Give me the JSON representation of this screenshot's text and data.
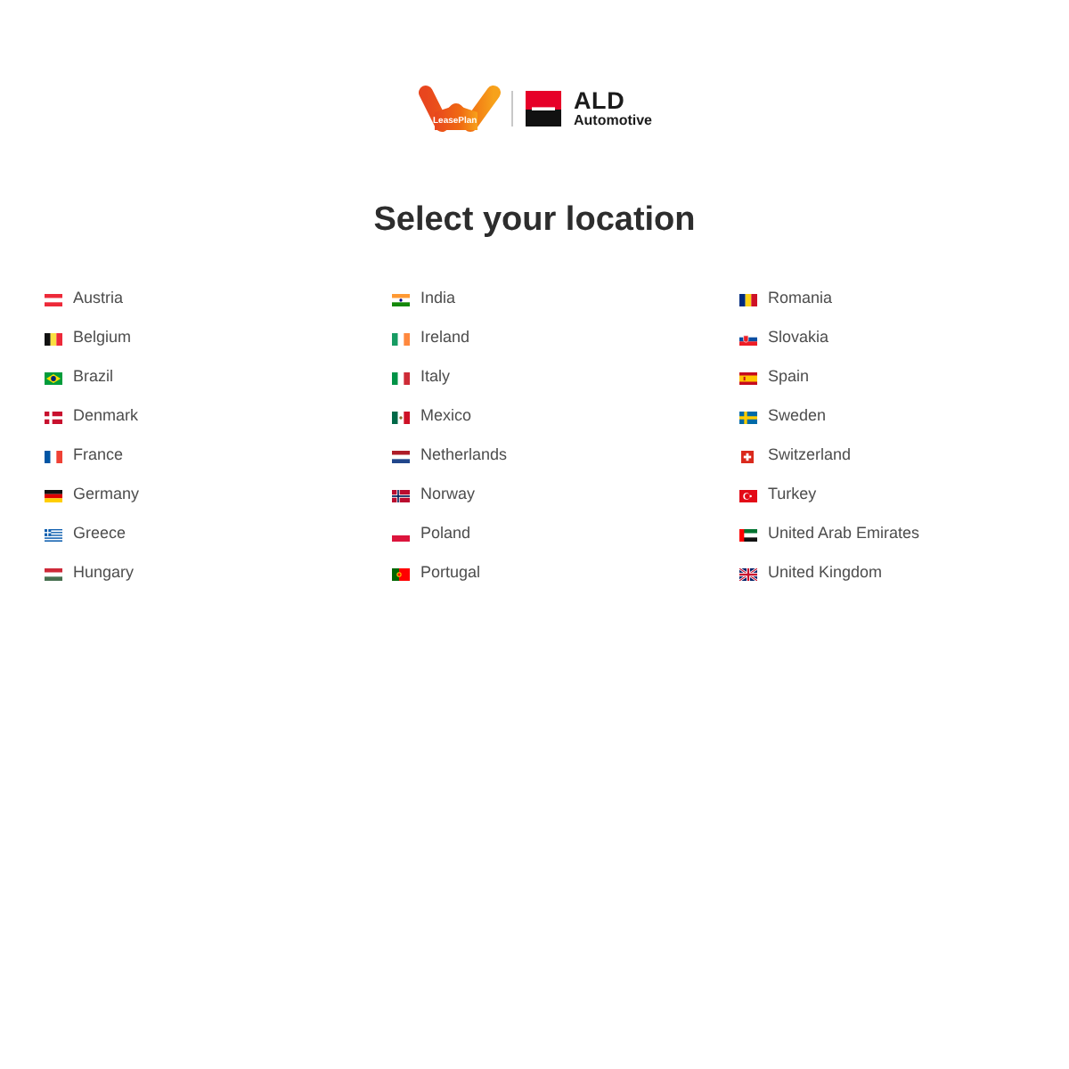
{
  "logo": {
    "leaseplan_text": "LeasePlan",
    "ald_text": "ALD",
    "ald_subtext": "Automotive"
  },
  "title": "Select your location",
  "columns": [
    [
      {
        "name": "Austria",
        "kind": "at"
      },
      {
        "name": "Belgium",
        "kind": "be"
      },
      {
        "name": "Brazil",
        "kind": "br"
      },
      {
        "name": "Denmark",
        "kind": "dk"
      },
      {
        "name": "France",
        "kind": "fr"
      },
      {
        "name": "Germany",
        "kind": "de"
      },
      {
        "name": "Greece",
        "kind": "gr"
      },
      {
        "name": "Hungary",
        "kind": "hu"
      }
    ],
    [
      {
        "name": "India",
        "kind": "in"
      },
      {
        "name": "Ireland",
        "kind": "ie"
      },
      {
        "name": "Italy",
        "kind": "it"
      },
      {
        "name": "Mexico",
        "kind": "mx"
      },
      {
        "name": "Netherlands",
        "kind": "nl"
      },
      {
        "name": "Norway",
        "kind": "no"
      },
      {
        "name": "Poland",
        "kind": "pl"
      },
      {
        "name": "Portugal",
        "kind": "pt"
      }
    ],
    [
      {
        "name": "Romania",
        "kind": "ro"
      },
      {
        "name": "Slovakia",
        "kind": "sk"
      },
      {
        "name": "Spain",
        "kind": "es"
      },
      {
        "name": "Sweden",
        "kind": "se"
      },
      {
        "name": "Switzerland",
        "kind": "ch"
      },
      {
        "name": "Turkey",
        "kind": "tr"
      },
      {
        "name": "United Arab Emirates",
        "kind": "ae"
      },
      {
        "name": "United Kingdom",
        "kind": "gb"
      }
    ]
  ]
}
